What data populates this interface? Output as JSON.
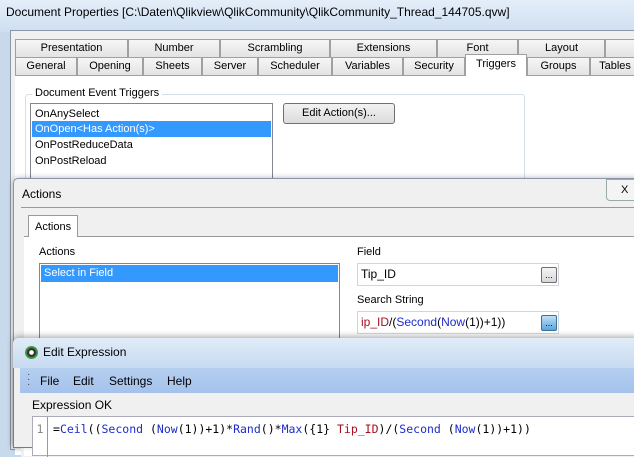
{
  "window": {
    "title": "Document Properties [C:\\Daten\\Qlikview\\QlikCommunity\\QlikCommunity_Thread_144705.qvw]"
  },
  "tabs_row1": [
    "Presentation",
    "Number",
    "Scrambling",
    "Extensions",
    "Font",
    "Layout",
    ""
  ],
  "tabs_row2": [
    "General",
    "Opening",
    "Sheets",
    "Server",
    "Scheduler",
    "Variables",
    "Security",
    "Triggers",
    "Groups",
    "Tables"
  ],
  "triggers": {
    "group_label": "Document Event Triggers",
    "items": [
      "OnAnySelect",
      "OnOpen<Has Action(s)>",
      "OnPostReduceData",
      "OnPostReload"
    ],
    "selected": 1,
    "edit_button": "Edit Action(s)..."
  },
  "actions_dialog": {
    "title": "Actions",
    "close": "X",
    "tab": "Actions",
    "list_label": "Actions",
    "items": [
      "Select in Field"
    ],
    "field_label": "Field",
    "field_value": "Tip_ID",
    "search_label": "Search String",
    "search_parts": [
      "ip_ID",
      "/(",
      "Second",
      "(",
      "Now",
      "(1))+1))"
    ],
    "browse": "..."
  },
  "edit_expression": {
    "title": "Edit Expression",
    "menu": [
      "File",
      "Edit",
      "Settings",
      "Help"
    ],
    "status": "Expression OK",
    "line_number": "1",
    "code": [
      [
        "=",
        ""
      ],
      [
        "Ceil",
        "kw"
      ],
      [
        "((",
        ""
      ],
      [
        "Second",
        "kw"
      ],
      [
        " (",
        ""
      ],
      [
        "Now",
        "kw"
      ],
      [
        "(1))+1)*",
        ""
      ],
      [
        "Rand",
        "kw"
      ],
      [
        "()*",
        ""
      ],
      [
        "Max",
        "kw"
      ],
      [
        "({1} ",
        ""
      ],
      [
        "Tip_ID",
        "fld"
      ],
      [
        ")/(",
        ""
      ],
      [
        "Second",
        "kw"
      ],
      [
        " (",
        ""
      ],
      [
        "Now",
        "kw"
      ],
      [
        "(1))+1))",
        ""
      ]
    ]
  }
}
